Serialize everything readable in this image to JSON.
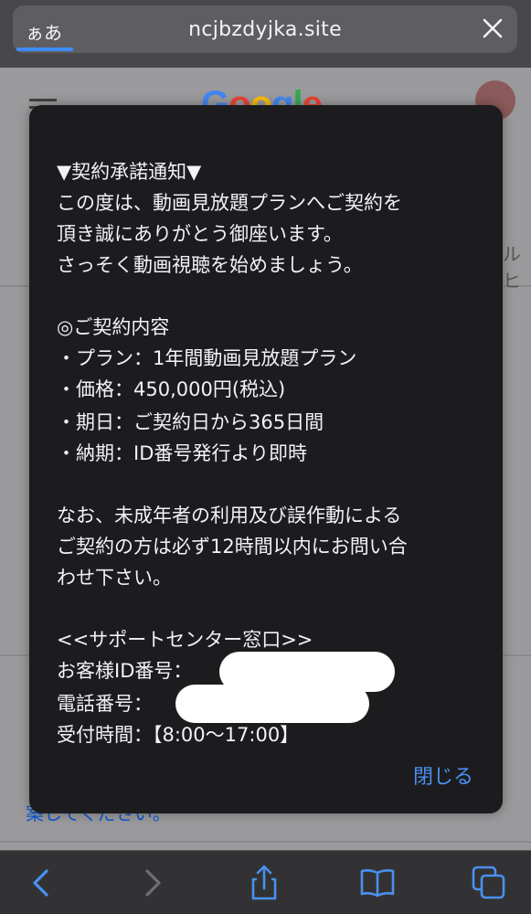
{
  "browser": {
    "reader_label": "ぁあ",
    "url": "ncjbzdyjka.site"
  },
  "background_page": {
    "logo_text": "Google",
    "partial_right": "ルヒ",
    "partial_link": "案してください。"
  },
  "dialog": {
    "lines": [
      "▼契約承諾通知▼",
      "この度は、動画見放題プランへご契約を",
      "頂き誠にありがとう御座います。",
      "さっそく動画視聴を始めましょう。",
      "◎ご契約内容",
      "・プラン：1年間動画見放題プラン",
      "・価格：450,000円(税込)",
      "・期日：ご契約日から365日間",
      "・納期：ID番号発行より即時",
      "なお、未成年者の利用及び誤作動による",
      "ご契約の方は必ず12時間以内にお問い合",
      "わせ下さい。",
      "<<サポートセンター窓口>>",
      "お客様ID番号：",
      "電話番号：",
      "受付時間：【8:00〜17:00】"
    ],
    "close_label": "閉じる"
  },
  "toolbar": {
    "items": [
      "back-icon",
      "forward-icon",
      "share-icon",
      "bookmarks-icon",
      "tabs-icon"
    ]
  },
  "colors": {
    "accent": "#4a90f0",
    "dialog_bg": "#1c1c1e",
    "progress": "#3d8bfd"
  }
}
